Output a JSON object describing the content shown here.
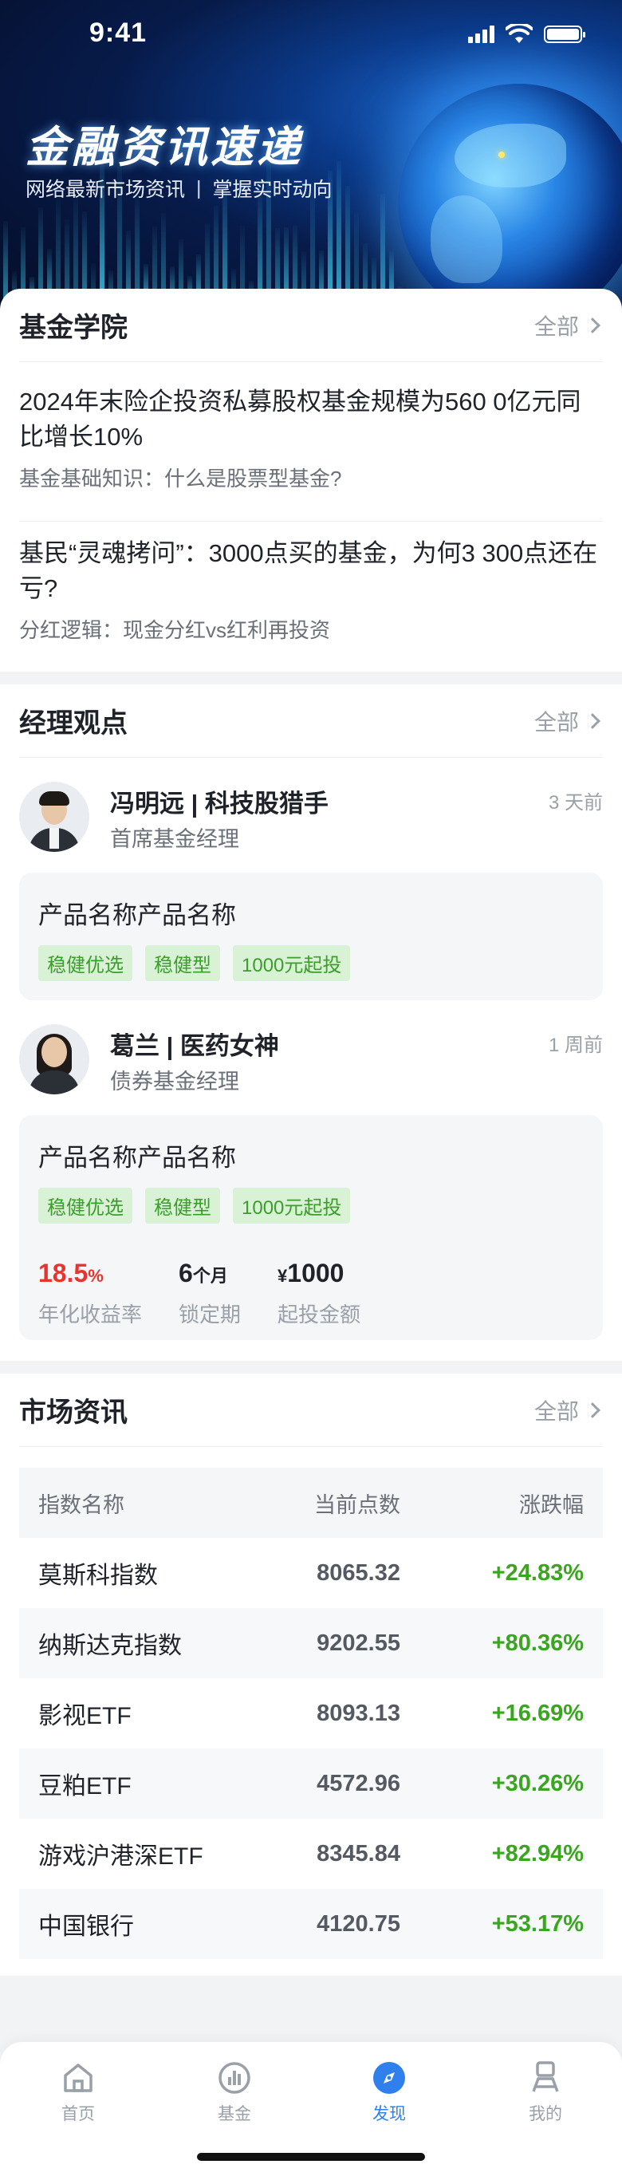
{
  "status": {
    "time": "9:41"
  },
  "hero": {
    "title": "金融资讯速递",
    "subtitle_left": "网络最新市场资讯",
    "separator": "|",
    "subtitle_right": "掌握实时动向"
  },
  "academy": {
    "title": "基金学院",
    "see_all": "全部",
    "articles": [
      {
        "title": "2024年末险企投资私募股权基金规模为560 0亿元同比增长10%",
        "sub": "基金基础知识：什么是股票型基金?"
      },
      {
        "title": "基民“灵魂拷问”：3000点买的基金，为何3 300点还在亏?",
        "sub": "分红逻辑：现金分红vs红利再投资"
      }
    ]
  },
  "views": {
    "title": "经理观点",
    "see_all": "全部",
    "managers": [
      {
        "name": "冯明远 | 科技股猎手",
        "role": "首席基金经理",
        "time": "3 天前",
        "product": {
          "name": "产品名称产品名称",
          "tags": [
            "稳健优选",
            "稳健型",
            "1000元起投"
          ]
        }
      },
      {
        "name": "葛兰 | 医药女神",
        "role": "债券基金经理",
        "time": "1 周前",
        "product": {
          "name": "产品名称产品名称",
          "tags": [
            "稳健优选",
            "稳健型",
            "1000元起投"
          ],
          "stats": [
            {
              "value": "18.5",
              "unit": "%",
              "label": "年化收益率"
            },
            {
              "value": "6",
              "unit": "个月",
              "label": "锁定期"
            },
            {
              "prefix": "¥",
              "value": "1000",
              "label": "起投金额"
            }
          ]
        }
      }
    ]
  },
  "market": {
    "title": "市场资讯",
    "see_all": "全部",
    "columns": [
      "指数名称",
      "当前点数",
      "涨跌幅"
    ],
    "rows": [
      {
        "name": "莫斯科指数",
        "value": "8065.32",
        "change": "+24.83%"
      },
      {
        "name": "纳斯达克指数",
        "value": "9202.55",
        "change": "+80.36%"
      },
      {
        "name": "影视ETF",
        "value": "8093.13",
        "change": "+16.69%"
      },
      {
        "name": "豆粕ETF",
        "value": "4572.96",
        "change": "+30.26%"
      },
      {
        "name": "游戏沪港深ETF",
        "value": "8345.84",
        "change": "+82.94%"
      },
      {
        "name": "中国银行",
        "value": "4120.75",
        "change": "+53.17%"
      }
    ]
  },
  "tabbar": {
    "items": [
      {
        "label": "首页",
        "icon": "home-icon"
      },
      {
        "label": "基金",
        "icon": "fund-icon"
      },
      {
        "label": "发现",
        "icon": "compass-icon",
        "active": true
      },
      {
        "label": "我的",
        "icon": "profile-icon"
      }
    ]
  },
  "colors": {
    "accent": "#2f80ed",
    "up": "#3aa51f",
    "highlight": "#e8332f",
    "tag_bg": "#d9f2d6"
  }
}
